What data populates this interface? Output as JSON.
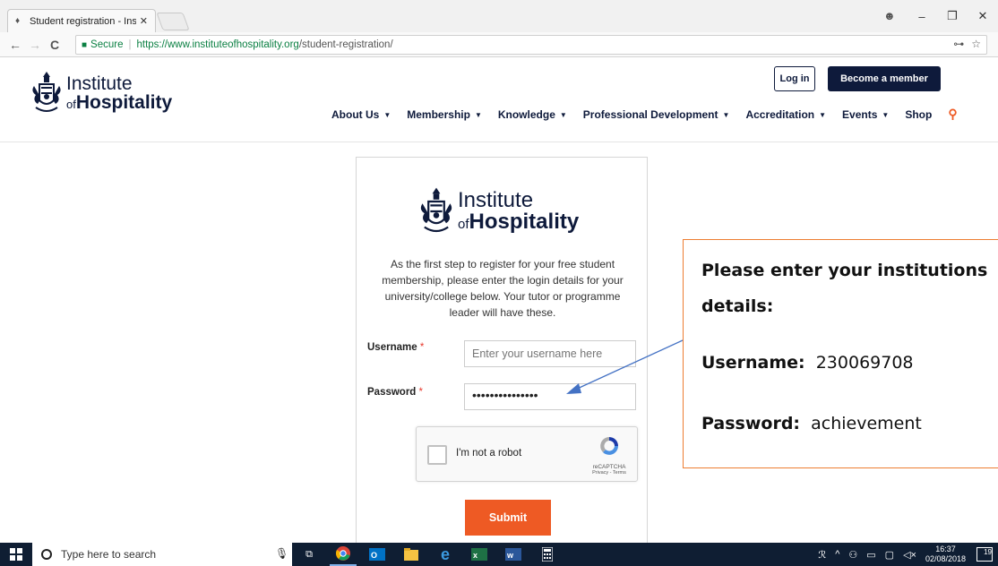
{
  "browser": {
    "tab_title": "Student registration - Ins",
    "tab_close": "✕",
    "win_min": "–",
    "win_max": "❐",
    "win_close": "✕",
    "account_icon": "☻",
    "back": "←",
    "forward": "→",
    "reload": "C",
    "secure_label": "Secure",
    "url_host": "https://www.instituteofhospitality.org",
    "url_path": "/student-registration/",
    "key_icon": "⊶",
    "star_icon": "☆",
    "menu_icon": "⋮"
  },
  "header": {
    "logo_line1": "Institute",
    "logo_of": "of",
    "logo_line2": "Hospitality",
    "login_label": "Log in",
    "member_label": "Become a member",
    "nav": [
      {
        "label": "About Us",
        "caret": "▼"
      },
      {
        "label": "Membership",
        "caret": "▼"
      },
      {
        "label": "Knowledge",
        "caret": "▼"
      },
      {
        "label": "Professional Development",
        "caret": "▼"
      },
      {
        "label": "Accreditation",
        "caret": "▼"
      },
      {
        "label": "Events",
        "caret": "▼"
      },
      {
        "label": "Shop",
        "caret": ""
      }
    ]
  },
  "form": {
    "logo_line1": "Institute",
    "logo_of": "of",
    "logo_line2": "Hospitality",
    "intro": "As the first step to register for your free student membership, please enter the login details for your university/college below. Your tutor or programme leader will have these.",
    "username_label": "Username",
    "username_placeholder": "Enter your username here",
    "password_label": "Password",
    "password_value": "•••••••••••••••",
    "required_mark": "*",
    "captcha_label": "I'm not a robot",
    "captcha_brand": "reCAPTCHA",
    "captcha_links": "Privacy - Terms",
    "submit_label": "Submit"
  },
  "callout": {
    "heading": "Please enter your institutions details:",
    "username_key": "Username:",
    "username_value": "230069708",
    "password_key": "Password:",
    "password_value": "achievement",
    "border_color": "#ed7d31"
  },
  "taskbar": {
    "search_placeholder": "Type here to search",
    "time": "16:37",
    "date": "02/08/2018",
    "notifications": "19"
  },
  "colors": {
    "brand_navy": "#0e1a3b",
    "accent_orange": "#ee5a24",
    "secure_green": "#0b8043"
  }
}
